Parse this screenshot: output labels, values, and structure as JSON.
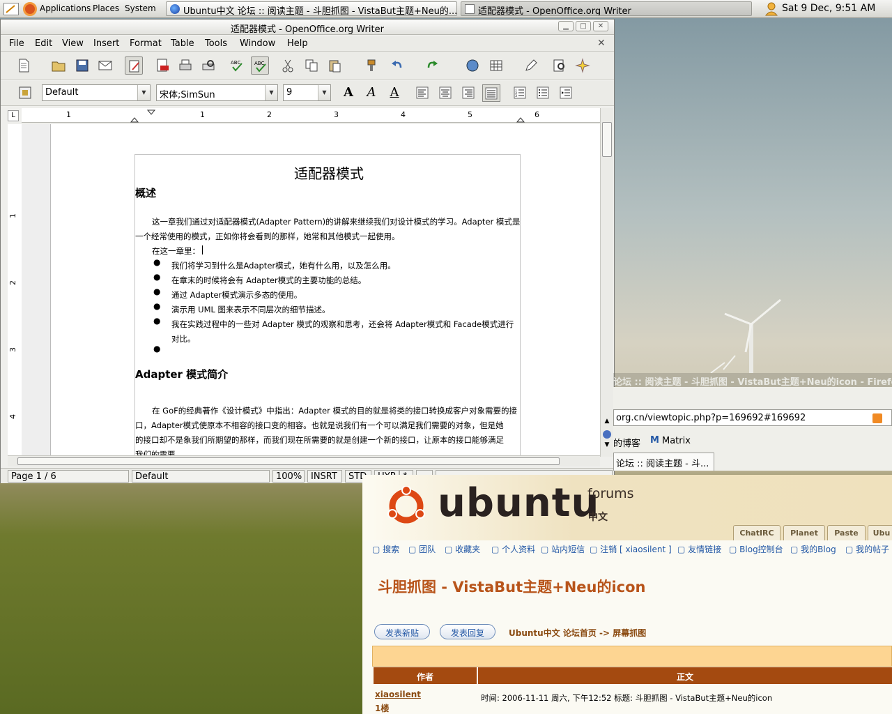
{
  "panel": {
    "applications": "Applications",
    "places": "Places",
    "system": "System",
    "clock": "Sat  9 Dec,  9:51 AM",
    "tasks": [
      "Ubuntu中文 论坛 :: 阅读主题 - 斗胆抓图 - VistaBut主题+Neu的...",
      "适配器模式 - OpenOffice.org Writer"
    ]
  },
  "writer": {
    "title": "适配器模式 - OpenOffice.org Writer",
    "menu": [
      "File",
      "Edit",
      "View",
      "Insert",
      "Format",
      "Table",
      "Tools",
      "Window",
      "Help"
    ],
    "style": "Default",
    "font": "宋体;SimSun",
    "size": "9",
    "ruler": [
      "1",
      "1",
      "2",
      "3",
      "4",
      "5",
      "6"
    ],
    "vruler": [
      "1",
      "2",
      "3",
      "4"
    ],
    "doc": {
      "h1": "适配器模式",
      "h2a": "概述",
      "p1a": "这一章我们通过对适配器模式(Adapter Pattern)的讲解来继续我们对设计模式的学习。Adapter 模式是",
      "p1b": "一个经常使用的模式，正如你将会看到的那样，她常和其他模式一起使用。",
      "p2": "在这一章里：",
      "bullets": [
        "我们将学习到什么是Adapter模式，她有什么用，以及怎么用。",
        "在章末的时候将会有 Adapter模式的主要功能的总结。",
        "通过 Adapter模式演示多态的使用。",
        "演示用 UML 图来表示不同层次的细节描述。",
        "我在实践过程中的一些对 Adapter 模式的观察和思考，还会将 Adapter模式和 Facade模式进行",
        "对比。"
      ],
      "h2b": "Adapter 模式简介",
      "p3a": "在 GoF的经典著作《设计模式》中指出：Adapter 模式的目的就是将类的接口转换成客户对象需要的接",
      "p3b": "口，Adapter模式使原本不相容的接口变的相容。也就是说我们有一个可以满足我们需要的对象，但是她",
      "p3c": "的接口却不是象我们所期望的那样，而我们现在所需要的就是创建一个新的接口，让原本的接口能够满足",
      "p3d": "我们的需要。"
    },
    "status": {
      "page": "Page 1 / 6",
      "style": "Default",
      "zoom": "100%",
      "insrt": "INSRT",
      "std": "STD",
      "hyp": "HYP",
      "mod": "*"
    }
  },
  "firefox": {
    "title": "论坛 :: 阅读主题 - 斗胆抓图 - VistaBut主题+Neu的icon - Firefox",
    "url": "org.cn/viewtopic.php?p=169692#169692",
    "bm1": "的博客",
    "bm2": "Matrix",
    "tab": "论坛 :: 阅读主题 - 斗...",
    "logo": "ubuntu",
    "forums": "forums",
    "zh": "中文",
    "tabs": [
      "ChatIRC",
      "Planet",
      "Paste",
      "Ubu"
    ],
    "nav": [
      "搜索",
      "团队",
      "收藏夹",
      "个人资料",
      "站内短信",
      "注销 [ xiaosilent ]",
      "友情链接",
      "Blog控制台",
      "我的Blog",
      "我的帖子"
    ],
    "topic": "斗胆抓图 - VistaBut主题+Neu的icon",
    "btn_new": "发表新贴",
    "btn_reply": "发表回复",
    "crumb": "Ubuntu中文 论坛首页 -> 屏幕抓图",
    "col_author": "作者",
    "col_body": "正文",
    "author": "xiaosilent",
    "floor": "1楼",
    "post_meta": "时间: 2006-11-11 周六, 下午12:52     标题: 斗胆抓图 - VistaBut主题+Neu的icon"
  }
}
